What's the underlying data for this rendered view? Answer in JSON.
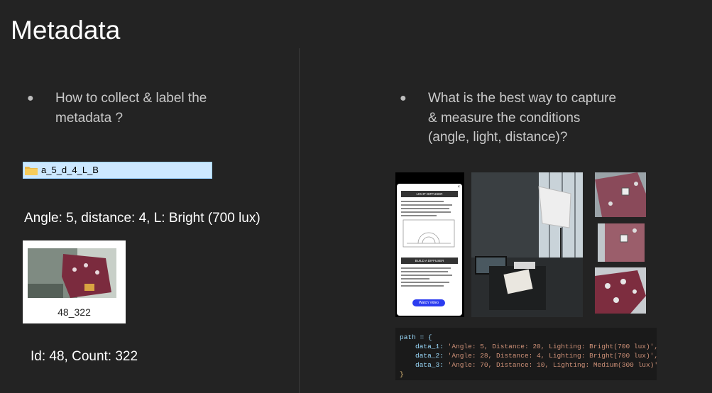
{
  "title": "Metadata",
  "left": {
    "bullet_line1": "How to collect & label the",
    "bullet_line2": "metadata ?",
    "folder_name": "a_5_d_4_L_B",
    "angle_caption": "Angle: 5, distance: 4, L: Bright (700 lux)",
    "thumbnail_label": "48_322",
    "id_caption": "Id: 48, Count: 322"
  },
  "right": {
    "bullet_line1": "What is the best way to capture",
    "bullet_line2": "& measure the conditions",
    "bullet_line3": "(angle, light, distance)?",
    "phone": {
      "header": "LIGHT DIFFUSER",
      "section2": "BUILD A DIFFUSER",
      "button": "Watch Video"
    },
    "code": {
      "open": "path = {",
      "d1_key": "data_1:",
      "d1_val": "'Angle: 5, Distance: 20, Lighting: Bright(700 lux)',",
      "d2_key": "data_2:",
      "d2_val": "'Angle: 28, Distance: 4, Lighting: Bright(700 lux)',",
      "d3_key": "data_3:",
      "d3_val": "'Angle: 70, Distance: 10, Lighting: Medium(300 lux)'",
      "close": "}"
    }
  },
  "colors": {
    "background": "#232323",
    "folder_highlight": "#cce8ff",
    "part_color": "#8a5a66",
    "button_blue": "#2b3cf0"
  }
}
